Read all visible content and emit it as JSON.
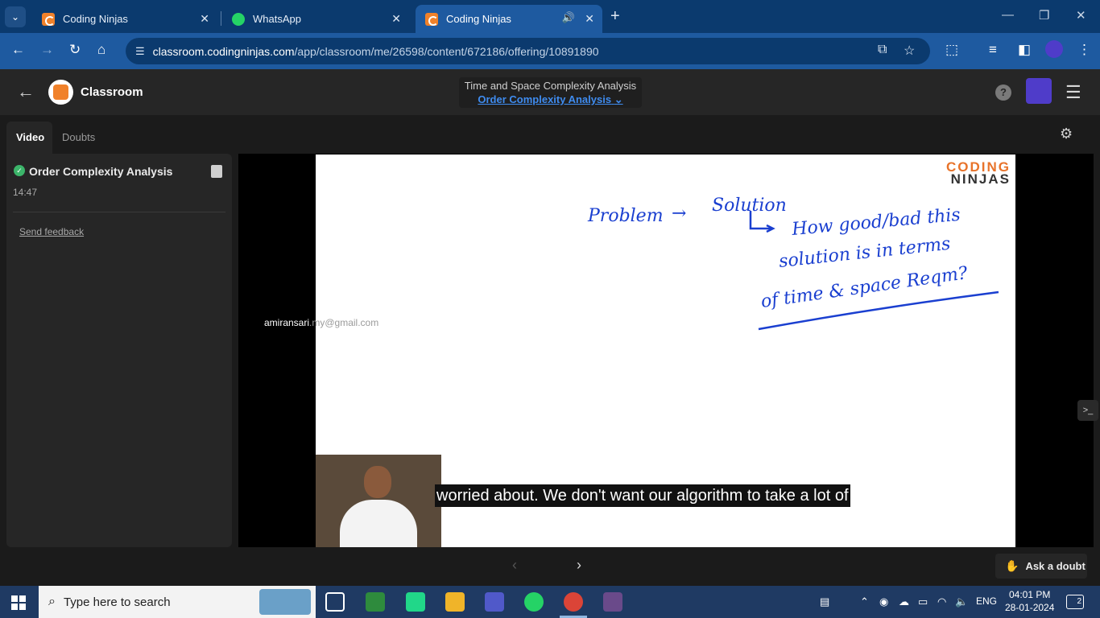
{
  "browser": {
    "tabs": [
      {
        "title": "Coding Ninjas",
        "icon": "coding-ninjas-favicon"
      },
      {
        "title": "WhatsApp",
        "icon": "whatsapp-favicon"
      },
      {
        "title": "Coding Ninjas",
        "icon": "coding-ninjas-favicon",
        "active": true,
        "audio": true
      }
    ],
    "url_host": "classroom.codingninjas.com",
    "url_path": "/app/classroom/me/26598/content/672186/offering/10891890"
  },
  "header": {
    "app_title": "Classroom",
    "course": "Time and Space Complexity Analysis",
    "lesson_select": "Order Complexity Analysis",
    "help_label": "?"
  },
  "sidebar": {
    "tabs": [
      "Video",
      "Doubts"
    ],
    "lesson_title": "Order Complexity Analysis",
    "lesson_duration": "14:47",
    "feedback": "Send feedback"
  },
  "video": {
    "brand_line1": "CODING",
    "brand_line2": "NINJAS",
    "watermark_name": "amiransari",
    "watermark_rest": ".my@gmail.com",
    "caption": "worried about. We don't want our algorithm to take a lot of",
    "handwriting": {
      "line1a": "Problem",
      "line1b": "Solution",
      "line2": "How good/bad this",
      "line3": "solution is in terms",
      "line4": "of time & space Reqm?"
    }
  },
  "footer": {
    "ask_label": "Ask a doubt"
  },
  "taskbar": {
    "search_placeholder": "Type here to search",
    "lang": "ENG",
    "time": "04:01 PM",
    "date": "28-01-2024",
    "notification_count": "2"
  },
  "colors": {
    "brand_orange": "#f0812a",
    "link_blue": "#3f8cf0",
    "ink_blue": "#1a3fd0",
    "browser_blue": "#1e5aa0"
  }
}
